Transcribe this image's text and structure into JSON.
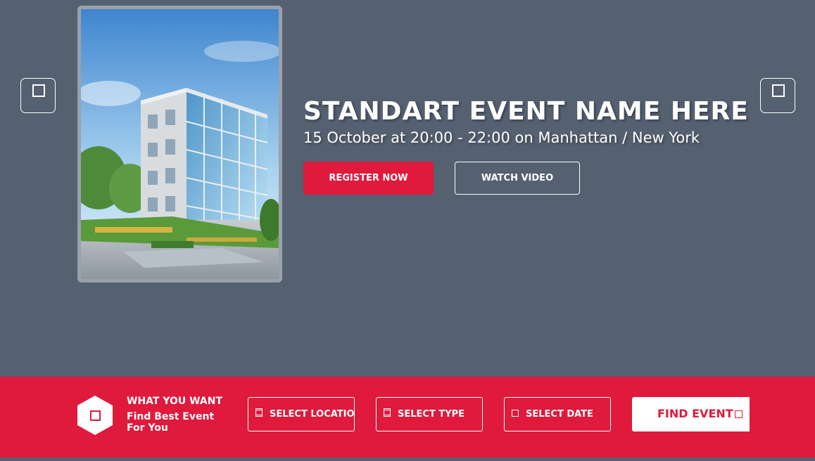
{
  "hero": {
    "title": "STANDART EVENT NAME HERE",
    "details": "15 October at 20:00 - 22:00 on Manhattan / New York",
    "register_label": "REGISTER NOW",
    "watch_label": "WATCH VIDEO"
  },
  "carousel": {
    "prev_icon": "square-icon",
    "next_icon": "square-icon"
  },
  "search": {
    "heading": "WHAT YOU WANT",
    "subheading": "Find Best Event For You",
    "filters": [
      {
        "label": "SELECT LOCATION",
        "icon": "square-icon"
      },
      {
        "label": "SELECT TYPE",
        "icon": "square-icon"
      },
      {
        "label": "SELECT DATE",
        "icon": "square-icon"
      }
    ],
    "find_label": "FIND EVENT"
  },
  "colors": {
    "background": "#556070",
    "accent": "#df1a3c",
    "text": "#ffffff"
  }
}
